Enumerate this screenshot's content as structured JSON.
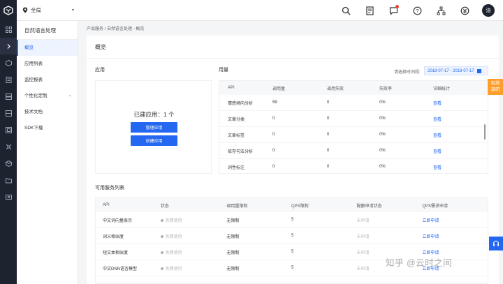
{
  "header": {
    "region": "全局",
    "avatar_text": "油",
    "icons": [
      "search-icon",
      "document-icon",
      "message-icon",
      "help-icon",
      "org-icon",
      "currency-icon"
    ],
    "accent_color": "#2468f2"
  },
  "rail": {
    "icons": [
      "grid-icon",
      "expand-icon",
      "cube-icon",
      "list-icon",
      "server-icon",
      "layers-icon",
      "database-icon",
      "network-icon",
      "box-icon",
      "folder-icon",
      "settings-icon"
    ]
  },
  "sidebar": {
    "title": "自然语言处理",
    "items": [
      {
        "label": "概览",
        "active": true
      },
      {
        "label": "应用列表"
      },
      {
        "label": "监控报表"
      },
      {
        "label": "个性化定制",
        "has_children": true
      },
      {
        "label": "技术文档"
      },
      {
        "label": "SDK下载"
      }
    ]
  },
  "breadcrumb": "产品服务 / 自然语言处理 - 概览",
  "page_title": "概览",
  "apps": {
    "label": "应用",
    "count_text": "已建应用：1 个",
    "manage_button": "管理应用",
    "create_button": "创建应用"
  },
  "usage": {
    "label": "用量",
    "date_label": "请选择时间段:",
    "date_range": "2018-07-17 - 2018-07-17",
    "columns": [
      "API",
      "调用量",
      "调用失败",
      "失败率",
      "详细统计"
    ],
    "rows": [
      {
        "api": "情感倾向分析",
        "calls": "59",
        "failed": "0",
        "rate": "0%",
        "action": "查看"
      },
      {
        "api": "文章分类",
        "calls": "0",
        "failed": "0",
        "rate": "0%",
        "action": "查看"
      },
      {
        "api": "文章标签",
        "calls": "0",
        "failed": "0",
        "rate": "0%",
        "action": "查看"
      },
      {
        "api": "依存句法分析",
        "calls": "0",
        "failed": "0",
        "rate": "0%",
        "action": "查看"
      },
      {
        "api": "词性标注",
        "calls": "0",
        "failed": "0",
        "rate": "0%",
        "action": "查看"
      }
    ]
  },
  "services": {
    "label": "可用服务列表",
    "columns": [
      "API",
      "状态",
      "调用量限制",
      "QPS限制",
      "配额申请状态",
      "QPS需求申请"
    ],
    "rows": [
      {
        "api": "中文词向量表示",
        "status": "免费使用",
        "limit": "无限制",
        "qps": "5",
        "quota": "未申请",
        "apply": "立即申请"
      },
      {
        "api": "词义相似度",
        "status": "免费使用",
        "limit": "无限制",
        "qps": "5",
        "quota": "未申请",
        "apply": "立即申请"
      },
      {
        "api": "短文本相似度",
        "status": "免费使用",
        "limit": "无限制",
        "qps": "5",
        "quota": "未申请",
        "apply": "立即申请"
      },
      {
        "api": "中文DNN语言模型",
        "status": "免费使用",
        "limit": "无限制",
        "qps": "5",
        "quota": "未申请",
        "apply": "立即申请"
      },
      {
        "api": "",
        "status": "",
        "limit": "",
        "qps": "",
        "quota": "",
        "apply": ""
      }
    ]
  },
  "float_tab": {
    "line1": "有奖",
    "line2": "调研"
  },
  "watermark": "知乎 @云时之间"
}
